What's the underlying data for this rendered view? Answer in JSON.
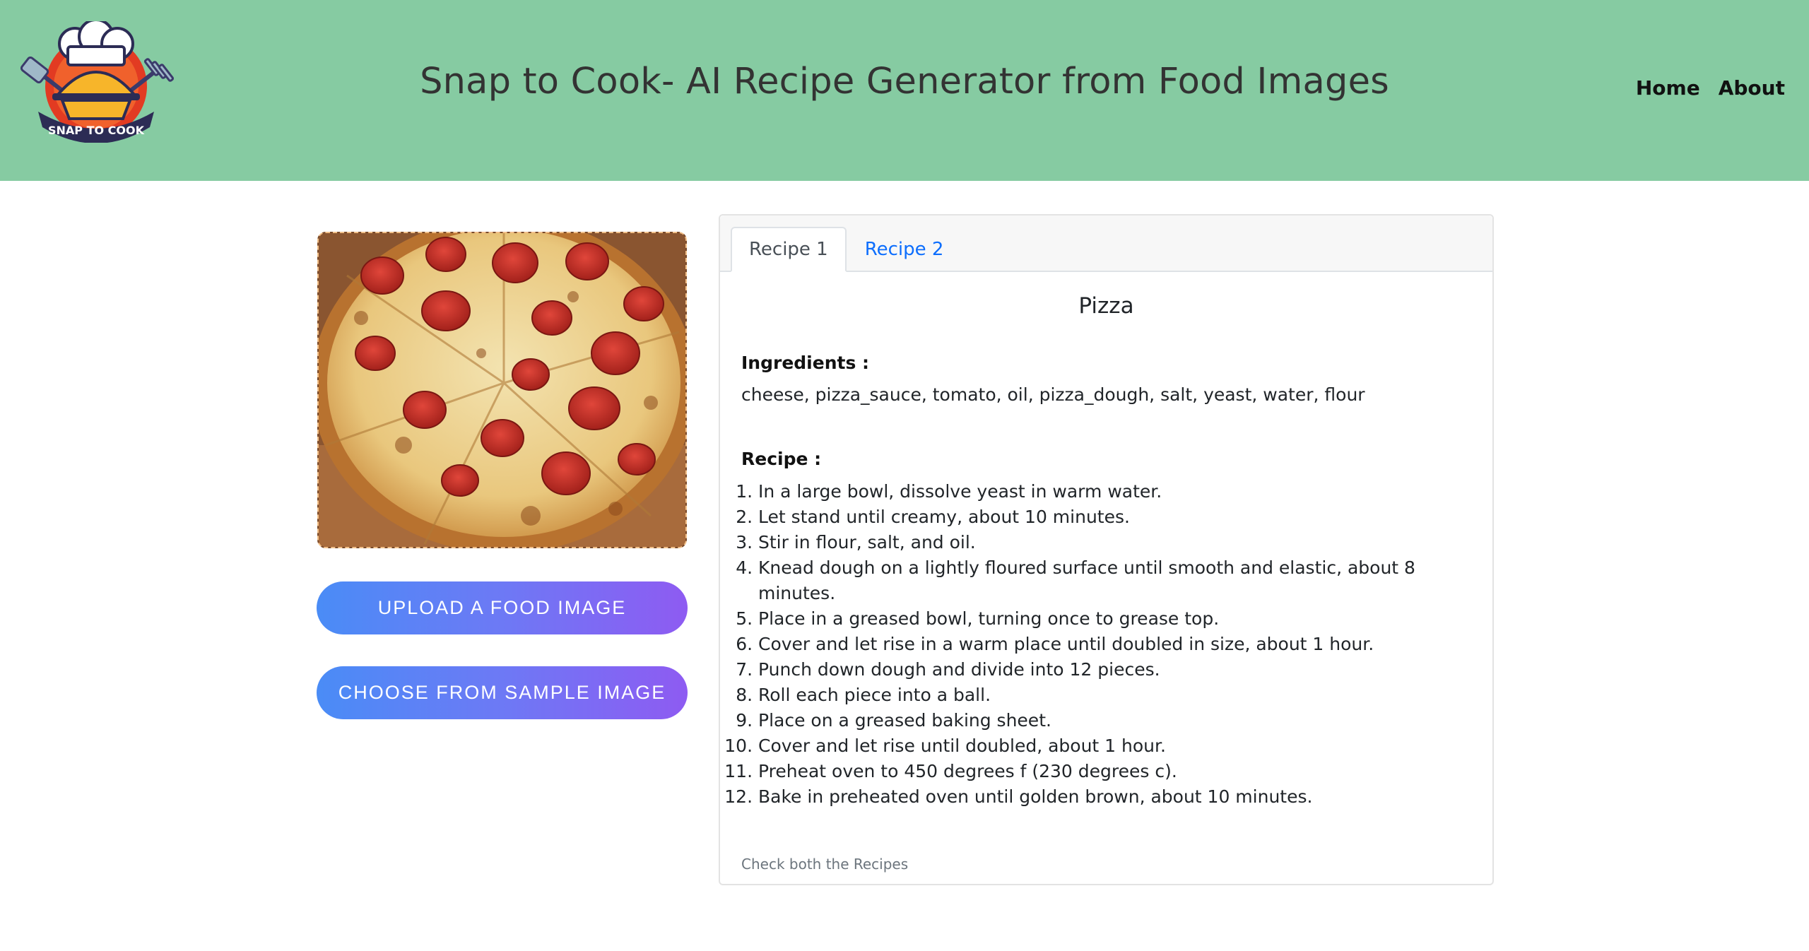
{
  "header": {
    "title": "Snap to Cook- AI Recipe Generator from Food Images",
    "logo_text": "SNAP TO COOK",
    "nav": [
      "Home",
      "About"
    ],
    "background": "#86cba2"
  },
  "left_panel": {
    "image_icon": "pizza-photo",
    "upload_label": "UPLOAD A FOOD IMAGE",
    "sample_label": "CHOOSE FROM SAMPLE IMAGE",
    "button_gradient": [
      "#4a8cf6",
      "#8e5bf2"
    ]
  },
  "recipe_card": {
    "tabs": [
      {
        "label": "Recipe 1",
        "active": true
      },
      {
        "label": "Recipe 2",
        "active": false
      }
    ],
    "dish_name": "Pizza",
    "ingredients_label": "Ingredients :",
    "ingredients": "cheese, pizza_sauce, tomato, oil, pizza_dough, salt, yeast, water, flour",
    "recipe_label": "Recipe :",
    "steps": [
      "In a large bowl, dissolve yeast in warm water.",
      "Let stand until creamy, about 10 minutes.",
      "Stir in flour, salt, and oil.",
      "Knead dough on a lightly floured surface until smooth and elastic, about 8 minutes.",
      "Place in a greased bowl, turning once to grease top.",
      "Cover and let rise in a warm place until doubled in size, about 1 hour.",
      "Punch down dough and divide into 12 pieces.",
      "Roll each piece into a ball.",
      "Place on a greased baking sheet.",
      "Cover and let rise until doubled, about 1 hour.",
      "Preheat oven to 450 degrees f (230 degrees c).",
      "Bake in preheated oven until golden brown, about 10 minutes."
    ],
    "footnote": "Check both the Recipes"
  }
}
